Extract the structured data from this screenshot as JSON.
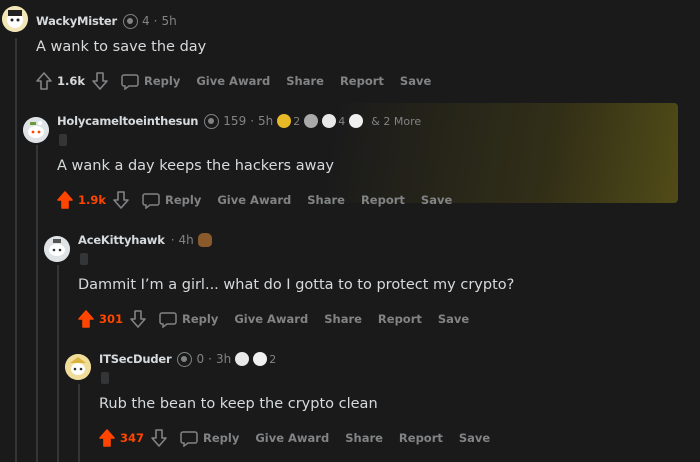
{
  "comments": [
    {
      "username": "WackyMister",
      "karma": "4",
      "time": "5h",
      "body": "A wank to save the day",
      "votes": "1.6k",
      "upvoted": false,
      "actions": [
        "Reply",
        "Give Award",
        "Share",
        "Report",
        "Save"
      ]
    },
    {
      "username": "Holycameltoeinthesun",
      "karma": "159",
      "time": "5h",
      "awards": [
        {
          "icon": "gold-award-icon",
          "count": "2"
        },
        {
          "icon": "silver-award-icon",
          "count": ""
        },
        {
          "icon": "wholesome-award-icon",
          "count": "4"
        },
        {
          "icon": "s-award-icon",
          "count": ""
        }
      ],
      "more_awards": "& 2 More",
      "body": "A wank a day keeps the hackers away",
      "votes": "1.9k",
      "upvoted": true,
      "actions": [
        "Reply",
        "Give Award",
        "Share",
        "Report",
        "Save"
      ]
    },
    {
      "username": "AceKittyhawk",
      "time": "4h",
      "body": "Dammit I’m a girl... what do I gotta to to protect my crypto?",
      "votes": "301",
      "upvoted": true,
      "actions": [
        "Reply",
        "Give Award",
        "Share",
        "Report",
        "Save"
      ]
    },
    {
      "username": "ITSecDuder",
      "karma": "0",
      "time": "3h",
      "awards": [
        {
          "icon": "wholesome-award-icon",
          "count": ""
        },
        {
          "icon": "s-award-icon",
          "count": "2"
        }
      ],
      "body": "Rub the bean to keep the crypto clean",
      "votes": "347",
      "upvoted": true,
      "actions": [
        "Reply",
        "Give Award",
        "Share",
        "Report",
        "Save"
      ]
    }
  ],
  "colors": {
    "upvote": "#ff4500",
    "text": "#d7dadc",
    "muted": "#818384",
    "background": "#1a1a1b"
  }
}
